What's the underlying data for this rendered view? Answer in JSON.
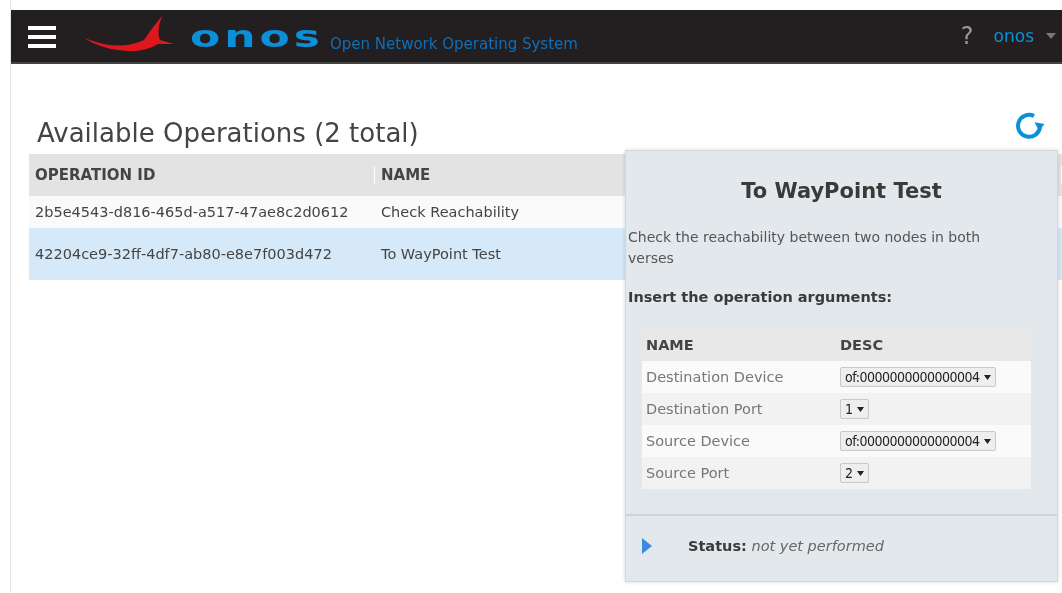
{
  "header": {
    "logo": "onos",
    "tagline": "Open Network Operating System",
    "help": "?",
    "user": "onos"
  },
  "page": {
    "title": "Available Operations (2 total)"
  },
  "table": {
    "columns": [
      "OPERATION ID",
      "NAME"
    ],
    "rows": [
      {
        "id": "2b5e4543-d816-465d-a517-47ae8c2d0612",
        "name": "Check Reachability",
        "selected": false
      },
      {
        "id": "42204ce9-32ff-4df7-ab80-e8e7f003d472",
        "name": "To WayPoint Test",
        "selected": true
      }
    ]
  },
  "panel": {
    "title": "To WayPoint Test",
    "description": "Check the reachability between two nodes in both verses",
    "arguments_heading": "Insert the operation arguments:",
    "arguments": {
      "columns": [
        "NAME",
        "DESC"
      ],
      "rows": [
        {
          "name": "Destination Device",
          "value": "of:0000000000000004"
        },
        {
          "name": "Destination Port",
          "value": "1"
        },
        {
          "name": "Source Device",
          "value": "of:0000000000000004"
        },
        {
          "name": "Source Port",
          "value": "2"
        }
      ]
    },
    "status": "**Status:** *not yet performed*",
    "expanded": false
  }
}
